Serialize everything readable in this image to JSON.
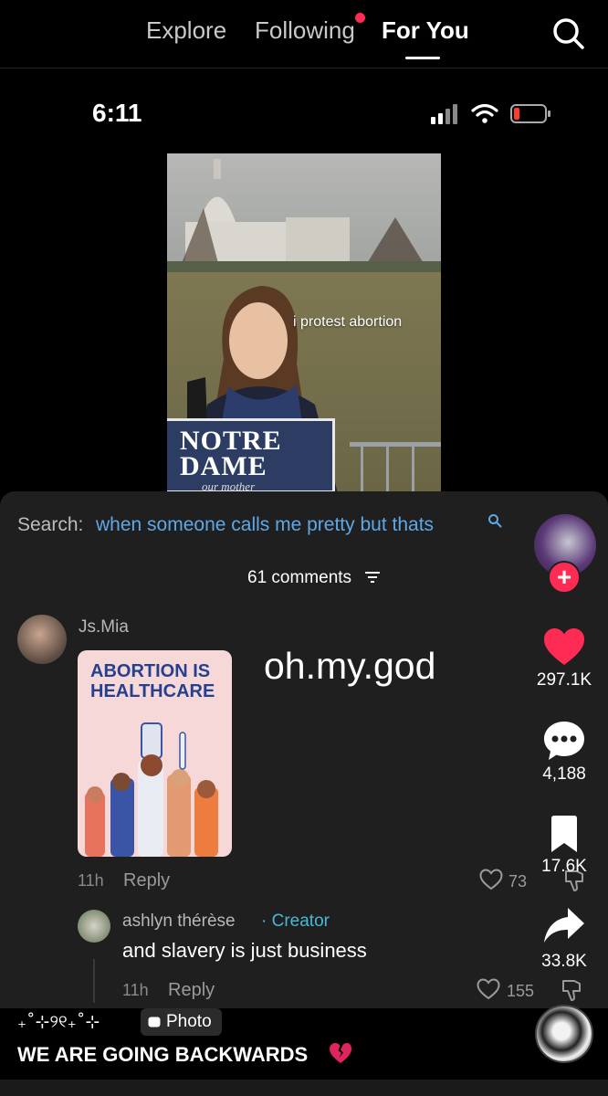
{
  "nav": {
    "tabs": [
      "Explore",
      "Following",
      "For You"
    ],
    "active_tab": "For You",
    "accent_color": "#fe2c55"
  },
  "status_bar": {
    "time": "6:11"
  },
  "video": {
    "overlay_text": "i protest abortion",
    "sign_title": "NOTRE DAME",
    "sign_subtitle": "our mother"
  },
  "comments_sheet": {
    "search_prefix": "Search:",
    "search_query": "when someone calls me pretty but thats",
    "count_label": "61 comments",
    "comments": [
      {
        "username": "Js.Mia",
        "sticker_text": "ABORTION IS HEALTHCARE",
        "text": "oh.my.god",
        "time": "11h",
        "reply_label": "Reply",
        "likes": "73"
      },
      {
        "username": "ashlyn thérèse",
        "creator_tag": "· Creator",
        "text": "and slavery is just business",
        "time": "11h",
        "reply_label": "Reply",
        "likes": "155"
      }
    ]
  },
  "rail": {
    "likes": "297.1K",
    "comments": "4,188",
    "saves": "17.6K",
    "shares": "33.8K",
    "follow_symbol": "+"
  },
  "caption": {
    "decoration": "₊˚⊹୨୧₊˚⊹",
    "badge_label": "Photo",
    "text": "WE ARE GOING BACKWARDS",
    "emoji": "broken-heart"
  }
}
